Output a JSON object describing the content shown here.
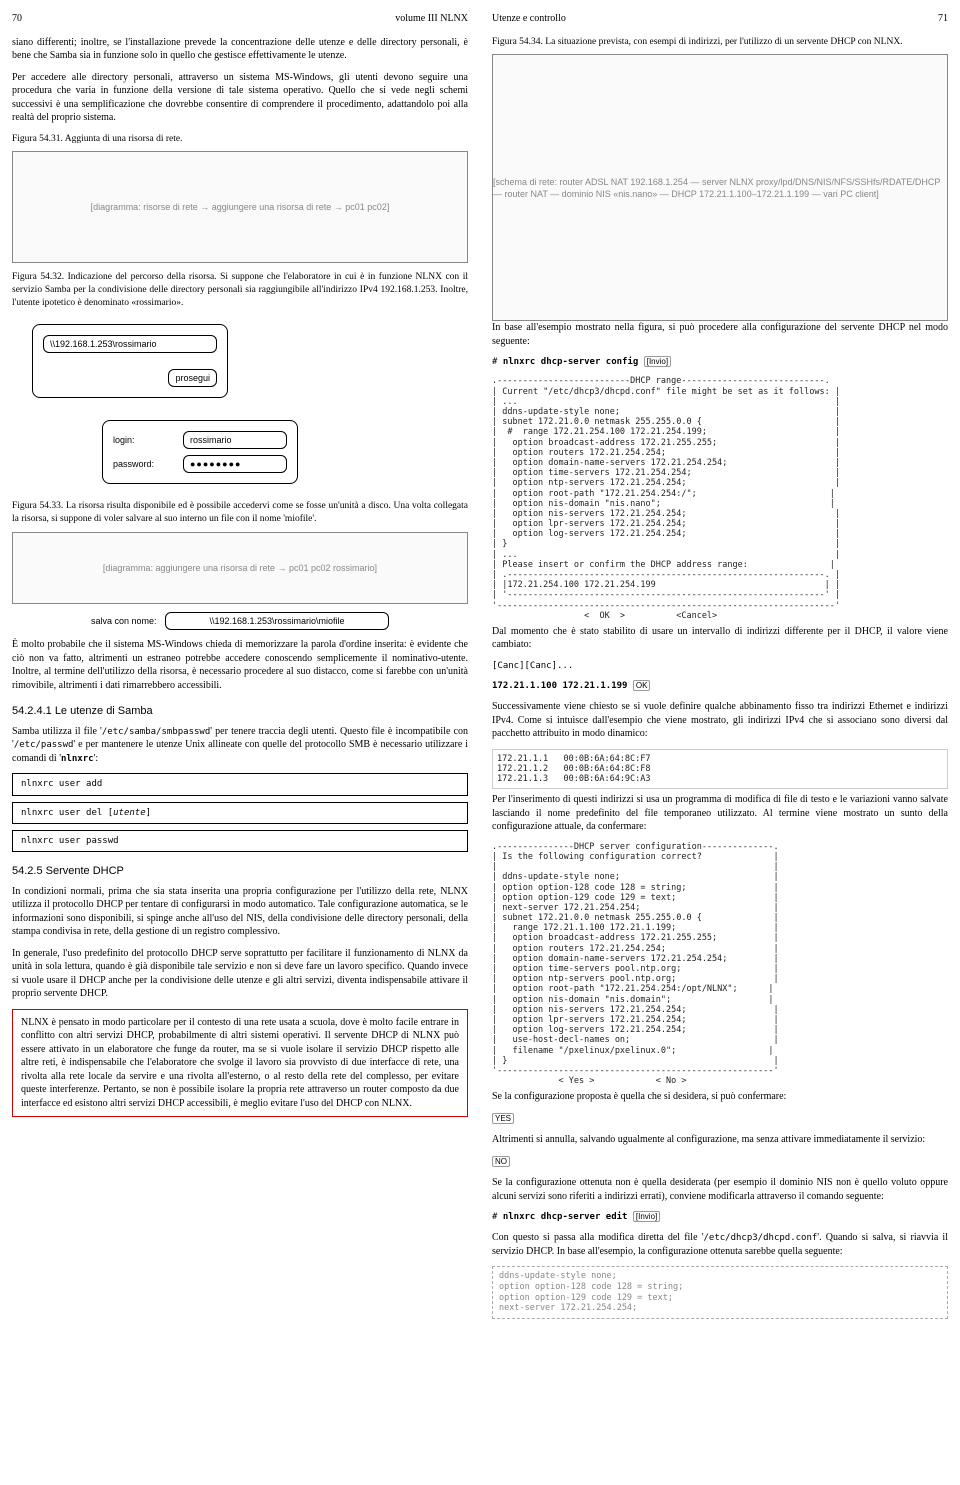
{
  "left": {
    "pgNumL": "70",
    "pgTitleL": "volume III   NLNX",
    "p1": "siano differenti; inoltre, se l'installazione prevede la concentrazione delle utenze e delle directory personali, è bene che Samba sia in funzione solo in quello che gestisce effettivamente le utenze.",
    "p2": "Per accedere alle directory personali, attraverso un sistema MS-Windows, gli utenti devono seguire una procedura che varia in funzione della versione di tale sistema operativo. Quello che si vede negli schemi successivi è una semplificazione che dovrebbe consentire di comprendere il procedimento, adattandolo poi alla realtà del proprio sistema.",
    "f31": "Figura 54.31. Aggiunta di una risorsa di rete.",
    "img31": "[diagramma: risorse di rete → aggiungere una risorsa di rete → pc01 pc02]",
    "f32": "Figura 54.32. Indicazione del percorso della risorsa. Si suppone che l'elaboratore in cui è in funzione NLNX con il servizio Samba per la condivisione delle directory personali sia raggiungibile all'indirizzo IPv4 192.168.1.253. Inoltre, l'utente ipotetico è denominato «rossimario».",
    "dlg32_path": "\\\\192.168.1.253\\rossimario",
    "dlg32_btn": "prosegui",
    "dlg32b_login_l": "login:",
    "dlg32b_login_v": "rossimario",
    "dlg32b_pass_l": "password:",
    "dlg32b_pass_v": "●●●●●●●●",
    "f33": "Figura 54.33. La risorsa risulta disponibile ed è possibile accedervi come se fosse un'unità a disco. Una volta collegata la risorsa, si suppone di voler salvare al suo interno un file con il nome 'miofile'.",
    "img33": "[diagramma: aggiungere una risorsa di rete → pc01 pc02 rossimario]",
    "save_l": "salva con nome:",
    "save_v": "\\\\192.168.1.253\\rossimario\\miofile",
    "p3": "È molto probabile che il sistema MS-Windows chieda di memorizzare la parola d'ordine inserita: è evidente che ciò non va fatto, altrimenti un estraneo potrebbe accedere conoscendo semplicemente il nominativo-utente. Inoltre, al termine dell'utilizzo della risorsa, è necessario procedere al suo distacco, come si farebbe con un'unità rimovibile, altrimenti i dati rimarrebbero accessibili.",
    "s5241": "54.2.4.1 Le utenze di Samba",
    "p4a": "Samba utilizza il file '",
    "p4b": "/etc/samba/smbpasswd",
    "p4c": "' per tenere traccia degli utenti. Questo file è incompatibile con '",
    "p4d": "/etc/passwd",
    "p4e": "' e per mantenere le utenze Unix allineate con quelle del protocollo SMB è necessario utilizzare i comandi di '",
    "p4f": "nlnxrc",
    "p4g": "':",
    "cmd1": "nlnxrc user add",
    "cmd2a": "nlnxrc user del ",
    "cmd2b": "[",
    "cmd2c": "utente",
    "cmd2d": "]",
    "cmd3": "nlnxrc user passwd",
    "s525": "54.2.5 Servente DHCP",
    "p5": "In condizioni normali, prima che sia stata inserita una propria configurazione per l'utilizzo della rete, NLNX utilizza il protocollo DHCP per tentare di configurarsi in modo automatico. Tale configurazione automatica, se le informazioni sono disponibili, si spinge anche all'uso del NIS, della condivisione delle directory personali, della stampa condivisa in rete, della gestione di un registro complessivo.",
    "p6": "In generale, l'uso predefinito del protocollo DHCP serve soprattutto per facilitare il funzionamento di NLNX da unità in sola lettura, quando è già disponibile tale servizio e non si deve fare un lavoro specifico. Quando invece si vuole usare il DHCP anche per la condivisione delle utenze e gli altri servizi, diventa indispensabile attivare il proprio servente DHCP.",
    "red": "NLNX è pensato in modo particolare per il contesto di una rete usata a scuola, dove è molto facile entrare in conflitto con altri servizi DHCP, probabilmente di altri sistemi operativi. Il servente DHCP di NLNX può essere attivato in un elaboratore che funge da router, ma se si vuole isolare il servizio DHCP rispetto alle altre reti, è indispensabile che l'elaboratore che svolge il lavoro sia provvisto di due interfacce di rete, una rivolta alla rete locale da servire e una rivolta all'esterno, o al resto della rete del complesso, per evitare queste interferenze. Pertanto, se non è possibile isolare la propria rete attraverso un router composto da due interfacce ed esistono altri servizi DHCP accessibili, è meglio evitare l'uso del DHCP con NLNX."
  },
  "right": {
    "pgTitleR": "Utenze e controllo",
    "pgNumR": "71",
    "f34": "Figura 54.34. La situazione prevista, con esempi di indirizzi, per l'utilizzo di un servente DHCP con NLNX.",
    "img34": "[schema di rete: router ADSL NAT 192.168.1.254 — server NLNX proxy/lpd/DNS/NIS/NFS/SSHfs/RDATE/DHCP — router NAT — dominio NIS «nis.nano» — DHCP 172.21.1.100–172.21.1.199 — vari PC client]",
    "p7": "In base all'esempio mostrato nella figura, si può procedere alla configurazione del servente DHCP nel modo seguente:",
    "cmdR1a": "# ",
    "cmdR1b": "nlnxrc dhcp-server config",
    "cmdR1c": "[Invio]",
    "code1": ".--------------------------DHCP range----------------------------.\n| Current \"/etc/dhcp3/dhcpd.conf\" file might be set as it follows: |\n| ...                                                              |\n| ddns-update-style none;                                          |\n| subnet 172.21.0.0 netmask 255.255.0.0 {                          |\n|  #  range 172.21.254.100 172.21.254.199;                         |\n|   option broadcast-address 172.21.255.255;                       |\n|   option routers 172.21.254.254;                                 |\n|   option domain-name-servers 172.21.254.254;                     |\n|   option time-servers 172.21.254.254;                            |\n|   option ntp-servers 172.21.254.254;                             |\n|   option root-path \"172.21.254.254:/\";                          |\n|   option nis-domain \"nis.nano\";                                 |\n|   option nis-servers 172.21.254.254;                             |\n|   option lpr-servers 172.21.254.254;                             |\n|   option log-servers 172.21.254.254;                             |\n| }                                                                |\n| ...                                                              |\n| Please insert or confirm the DHCP address range:                |\n| .--------------------------------------------------------------. |\n| |172.21.254.100 172.21.254.199                                 | |\n| '--------------------------------------------------------------' |\n'------------------------------------------------------------------'\n                  <  OK  >          <Cancel>",
    "p8": "Dal momento che è stato stabilito di usare un intervallo di indirizzi differente per il DHCP, il valore viene cambiato:",
    "seqCanc": "[Canc][Canc]...",
    "cmdR2a": "172.21.1.100 172.21.1.199",
    "cmdR2b": "OK",
    "p9": "Successivamente viene chiesto se si vuole definire qualche abbinamento fisso tra indirizzi Ethernet e indirizzi IPv4. Come si intuisce dall'esempio che viene mostrato, gli indirizzi IPv4 che si associano sono diversi dal pacchetto attribuito in modo dinamico:",
    "code2": "172.21.1.1   00:0B:6A:64:8C:F7\n172.21.1.2   00:0B:6A:64:8C:F8\n172.21.1.3   00:0B:6A:64:9C:A3",
    "p10": "Per l'inserimento di questi indirizzi si usa un programma di modifica di file di testo e le variazioni vanno salvate lasciando il nome predefinito del file temporaneo utilizzato. Al termine viene mostrato un sunto della configurazione attuale, da confermare:",
    "code3": ".---------------DHCP server configuration--------------.\n| Is the following configuration correct?              |\n|                                                      |\n| ddns-update-style none;                              |\n| option option-128 code 128 = string;                 |\n| option option-129 code 129 = text;                   |\n| next-server 172.21.254.254;                          |\n| subnet 172.21.0.0 netmask 255.255.0.0 {              |\n|   range 172.21.1.100 172.21.1.199;                   |\n|   option broadcast-address 172.21.255.255;           |\n|   option routers 172.21.254.254;                     |\n|   option domain-name-servers 172.21.254.254;         |\n|   option time-servers pool.ntp.org;                  |\n|   option ntp-servers pool.ntp.org;                   |\n|   option root-path \"172.21.254.254:/opt/NLNX\";      |\n|   option nis-domain \"nis.domain\";                   |\n|   option nis-servers 172.21.254.254;                 |\n|   option lpr-servers 172.21.254.254;                 |\n|   option log-servers 172.21.254.254;                 |\n|   use-host-decl-names on;                            |\n|   filename \"/pxelinux/pxelinux.0\";                  |\n| }                                                    |\n'------------------------------------------------------'\n             < Yes >            < No >",
    "p11": "Se la configurazione proposta è quella che si desidera, si può confermare:",
    "keyYes": "YES",
    "p12": "Altrimenti si annulla, salvando ugualmente al configurazione, ma senza attivare immediatamente il servizio:",
    "keyNo": "NO",
    "p13": "Se la configurazione ottenuta non è quella desiderata (per esempio il dominio NIS non è quello voluto oppure alcuni servizi sono riferiti a indirizzi errati), conviene modificarla attraverso il comando seguente:",
    "cmdR3a": "# ",
    "cmdR3b": "nlnxrc dhcp-server edit",
    "cmdR3c": "[Invio]",
    "p14a": "Con questo si passa alla modifica diretta del file '",
    "p14b": "/etc/dhcp3/dhcpd.conf",
    "p14c": "'. Quando si salva, si riavvia il servizio DHCP. In base all'esempio, la configurazione ottenuta sarebbe quella seguente:",
    "code4": "ddns-update-style none;\noption option-128 code 128 = string;\noption option-129 code 129 = text;\nnext-server 172.21.254.254;"
  }
}
